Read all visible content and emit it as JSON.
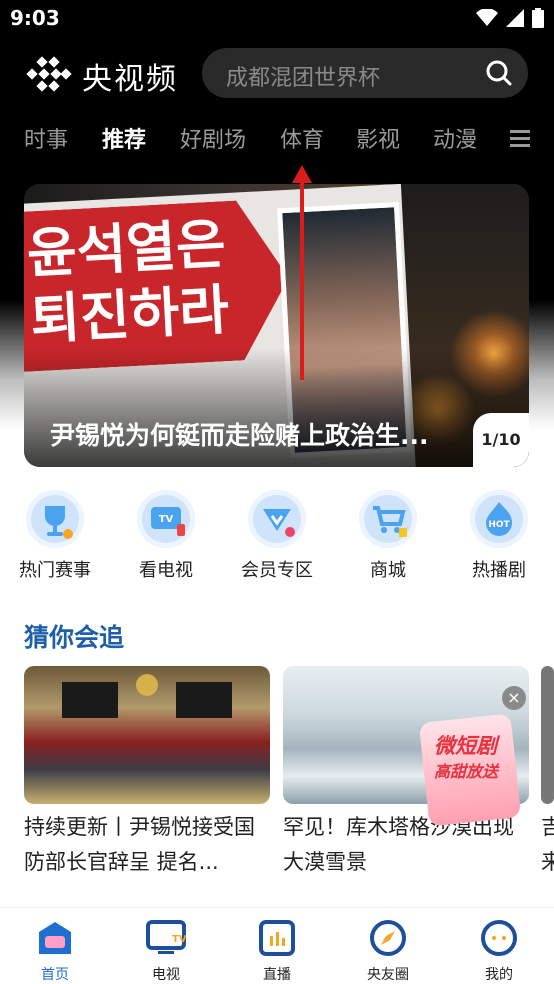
{
  "status": {
    "time": "9:03"
  },
  "header": {
    "app_name": "央视频",
    "search_placeholder": "成都混团世界杯"
  },
  "tabs": [
    {
      "label": "时事"
    },
    {
      "label": "推荐",
      "active": true
    },
    {
      "label": "好剧场"
    },
    {
      "label": "体育"
    },
    {
      "label": "影视"
    },
    {
      "label": "动漫"
    }
  ],
  "banner": {
    "title": "尹锡悦为何铤而走险赌上政治生...",
    "counter": "1/10",
    "sign_line1": "윤석열은",
    "sign_line2": "퇴진하라"
  },
  "quick_links": [
    {
      "label": "热门赛事",
      "icon": "trophy-icon"
    },
    {
      "label": "看电视",
      "icon": "tv-icon"
    },
    {
      "label": "会员专区",
      "icon": "vip-icon"
    },
    {
      "label": "商城",
      "icon": "cart-icon"
    },
    {
      "label": "热播剧",
      "icon": "hot-icon"
    }
  ],
  "section": {
    "title": "猜你会追"
  },
  "cards": [
    {
      "title": "持续更新丨尹锡悦接受国防部长官辞呈 提名..."
    },
    {
      "title": "罕见！库木塔格沙漠出现大漠雪景",
      "ad_line1": "微短剧",
      "ad_line2": "高甜放送"
    },
    {
      "title": "吉来"
    }
  ],
  "tabbar": [
    {
      "label": "首页",
      "active": true,
      "icon": "home-icon"
    },
    {
      "label": "电视",
      "icon": "tv-icon"
    },
    {
      "label": "直播",
      "icon": "live-icon"
    },
    {
      "label": "央友圈",
      "icon": "compass-icon"
    },
    {
      "label": "我的",
      "icon": "profile-icon"
    }
  ],
  "colors": {
    "accent": "#1e5faa",
    "active_tab": "#1e6fd0",
    "sign_red": "#c8262b",
    "arrow_red": "#d91c1c"
  }
}
